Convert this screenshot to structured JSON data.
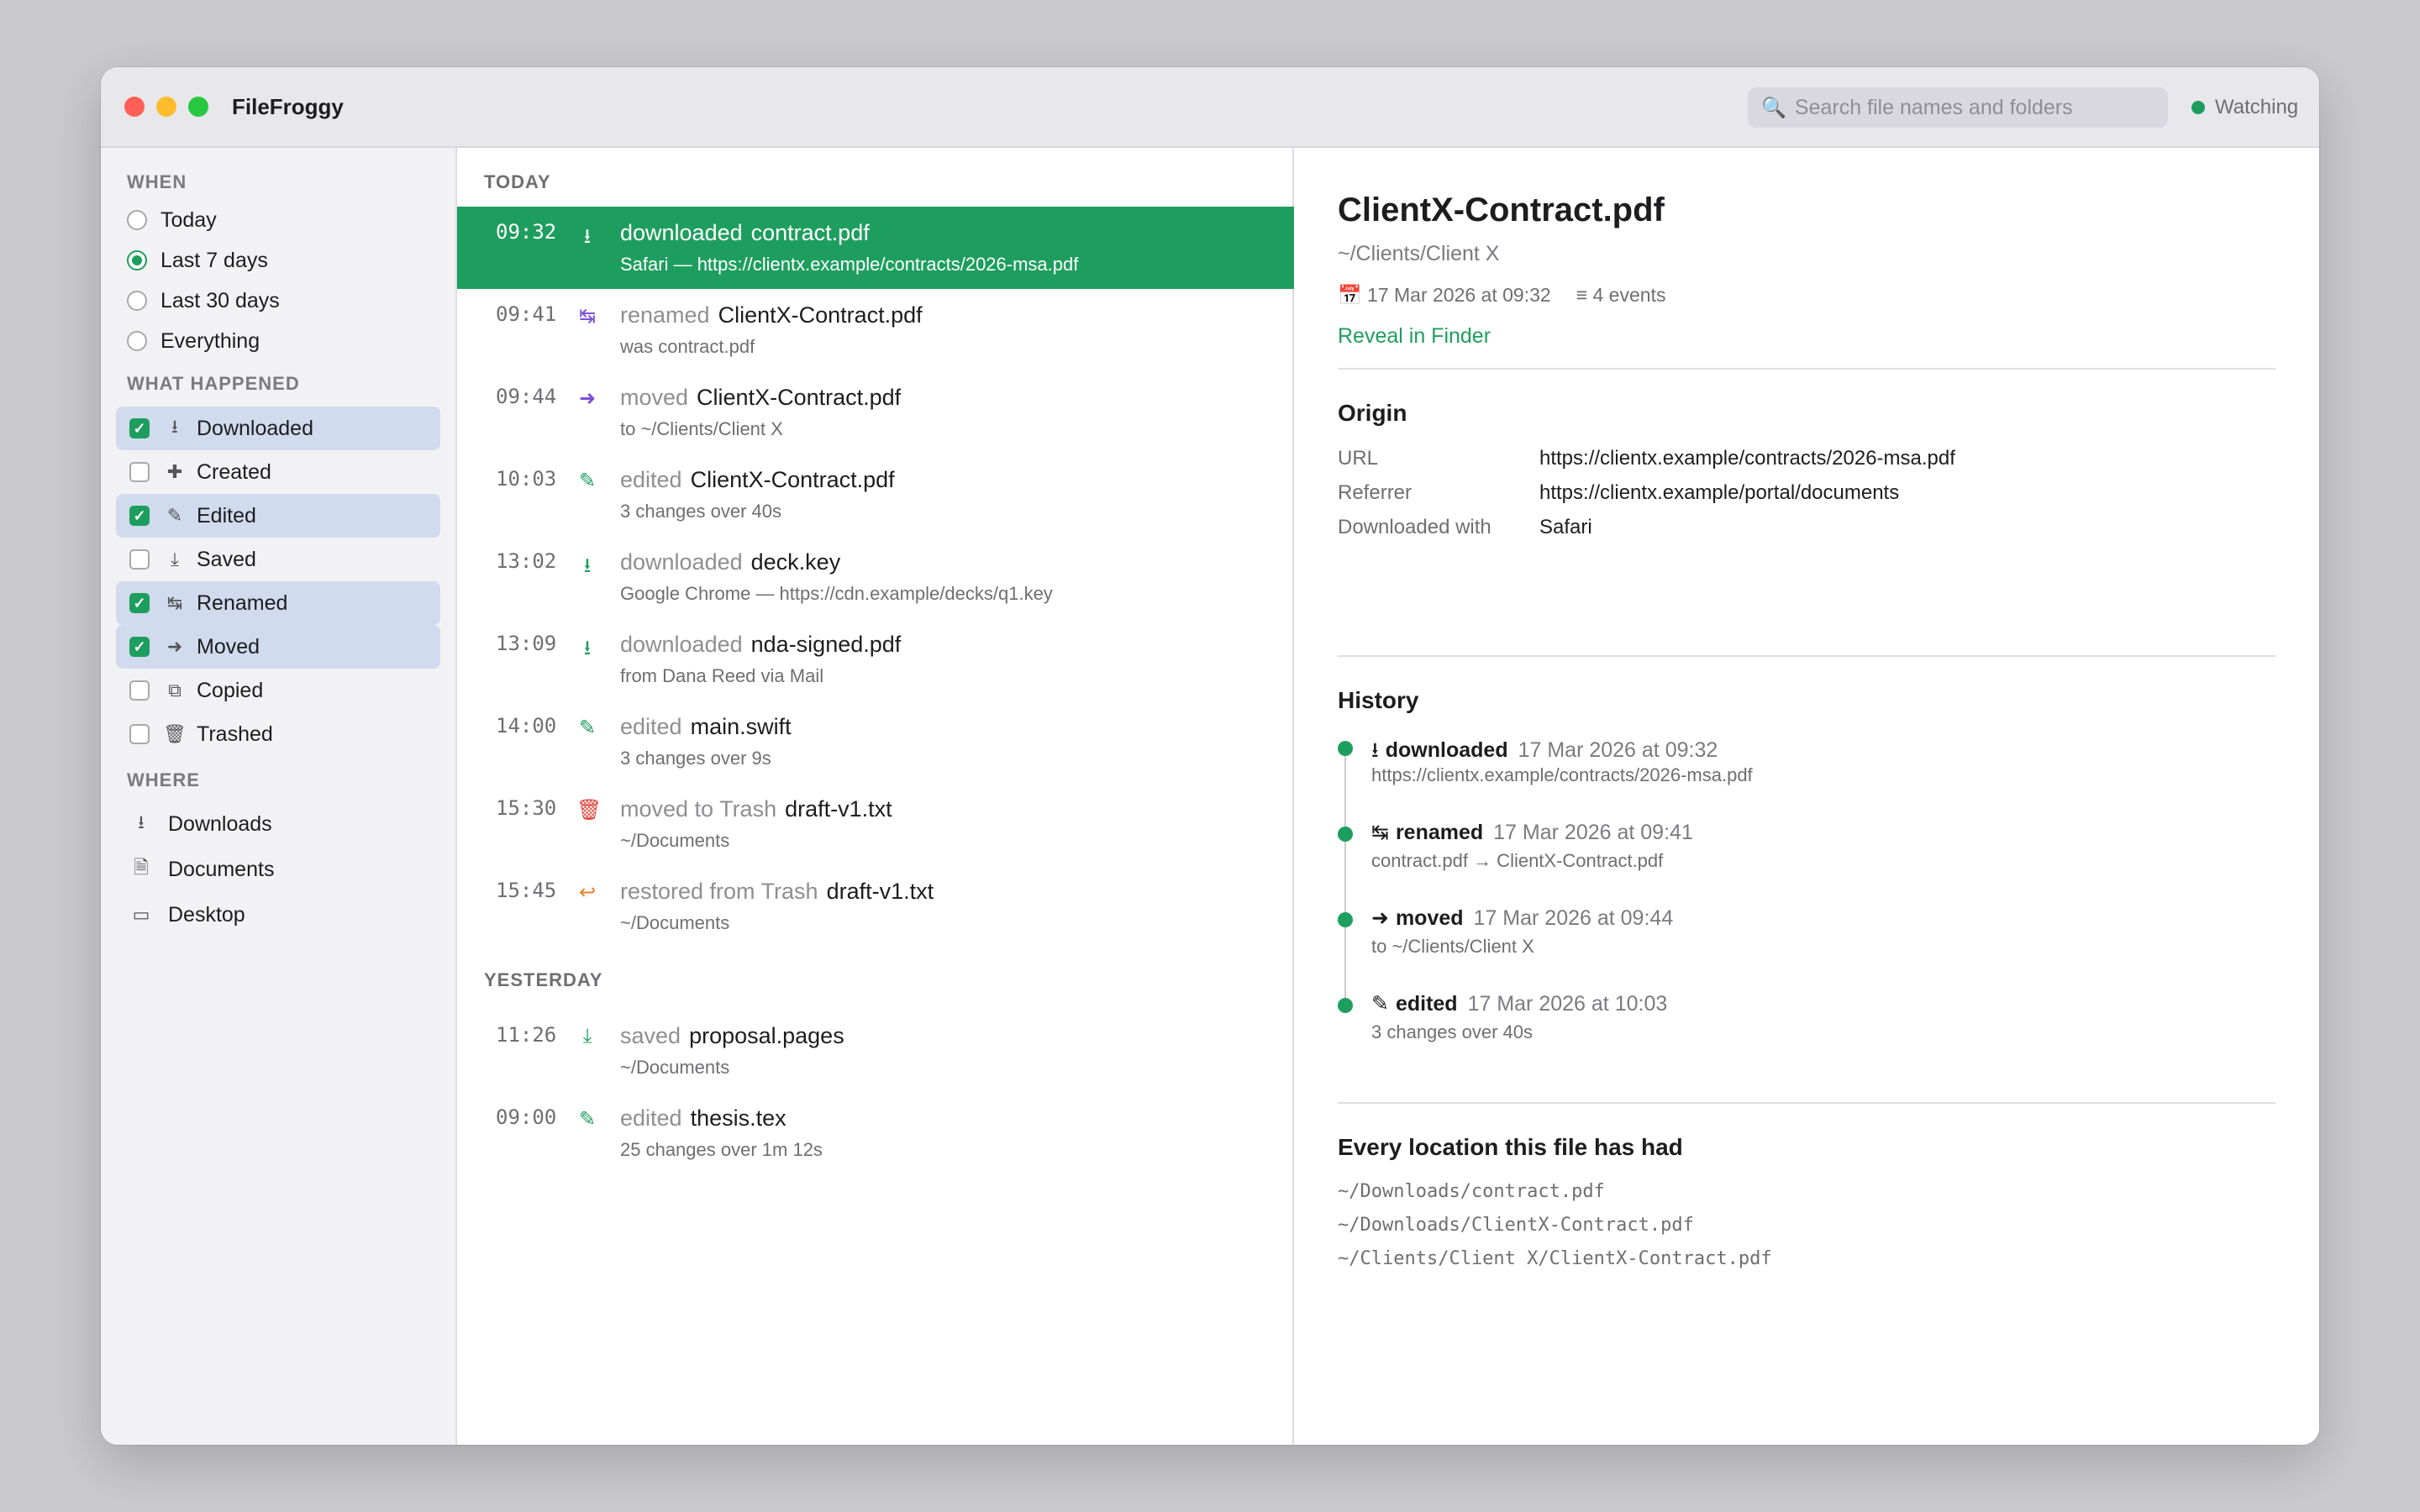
{
  "app": {
    "title": "FileFroggy"
  },
  "search": {
    "placeholder": "Search file names and folders"
  },
  "status": {
    "label": "Watching",
    "color": "#1e9e5e"
  },
  "sidebar": {
    "when_heading": "WHEN",
    "when": [
      {
        "label": "Today",
        "selected": false
      },
      {
        "label": "Last 7 days",
        "selected": true
      },
      {
        "label": "Last 30 days",
        "selected": false
      },
      {
        "label": "Everything",
        "selected": false
      }
    ],
    "what_heading": "WHAT HAPPENED",
    "what": [
      {
        "label": "Downloaded",
        "icon": "⭳",
        "checked": true
      },
      {
        "label": "Created",
        "icon": "✚",
        "checked": false
      },
      {
        "label": "Edited",
        "icon": "✎",
        "checked": true
      },
      {
        "label": "Saved",
        "icon": "⤓",
        "checked": false
      },
      {
        "label": "Renamed",
        "icon": "↹",
        "checked": true
      },
      {
        "label": "Moved",
        "icon": "➜",
        "checked": true
      },
      {
        "label": "Copied",
        "icon": "⧉",
        "checked": false
      },
      {
        "label": "Trashed",
        "icon": "🗑",
        "checked": false
      }
    ],
    "where_heading": "WHERE",
    "where": [
      {
        "label": "Downloads",
        "icon": "⭳"
      },
      {
        "label": "Documents",
        "icon": "🗎"
      },
      {
        "label": "Desktop",
        "icon": "▭"
      }
    ]
  },
  "timeline": {
    "today_heading": "TODAY",
    "yesterday_heading": "YESTERDAY",
    "today": [
      {
        "time": "09:32",
        "icon": "⭳",
        "icon_color": "#1e9e5e",
        "action": "downloaded",
        "file": "contract.pdf",
        "sub": "Safari — https://clientx.example/contracts/2026-msa.pdf",
        "selected": true
      },
      {
        "time": "09:41",
        "icon": "↹",
        "icon_color": "#7b4fd6",
        "action": "renamed",
        "file": "ClientX-Contract.pdf",
        "sub": "was contract.pdf",
        "selected": false
      },
      {
        "time": "09:44",
        "icon": "➜",
        "icon_color": "#7b4fd6",
        "action": "moved",
        "file": "ClientX-Contract.pdf",
        "sub": "to ~/Clients/Client X",
        "selected": false
      },
      {
        "time": "10:03",
        "icon": "✎",
        "icon_color": "#1e9e5e",
        "action": "edited",
        "file": "ClientX-Contract.pdf",
        "sub": "3 changes over 40s",
        "selected": false
      },
      {
        "time": "13:02",
        "icon": "⭳",
        "icon_color": "#1e9e5e",
        "action": "downloaded",
        "file": "deck.key",
        "sub": "Google Chrome — https://cdn.example/decks/q1.key",
        "selected": false
      },
      {
        "time": "13:09",
        "icon": "⭳",
        "icon_color": "#1e9e5e",
        "action": "downloaded",
        "file": "nda-signed.pdf",
        "sub": "from Dana Reed via Mail",
        "selected": false
      },
      {
        "time": "14:00",
        "icon": "✎",
        "icon_color": "#1e9e5e",
        "action": "edited",
        "file": "main.swift",
        "sub": "3 changes over 9s",
        "selected": false
      },
      {
        "time": "15:30",
        "icon": "🗑",
        "icon_color": "#e0413a",
        "action": "moved to Trash",
        "file": "draft-v1.txt",
        "sub": "~/Documents",
        "selected": false
      },
      {
        "time": "15:45",
        "icon": "↩",
        "icon_color": "#e8832a",
        "action": "restored from Trash",
        "file": "draft-v1.txt",
        "sub": "~/Documents",
        "selected": false
      }
    ],
    "yesterday": [
      {
        "time": "11:26",
        "icon": "⤓",
        "icon_color": "#1e9e5e",
        "action": "saved",
        "file": "proposal.pages",
        "sub": "~/Documents",
        "selected": false
      },
      {
        "time": "09:00",
        "icon": "✎",
        "icon_color": "#1e9e5e",
        "action": "edited",
        "file": "thesis.tex",
        "sub": "25 changes over 1m 12s",
        "selected": false
      }
    ]
  },
  "detail": {
    "title": "ClientX-Contract.pdf",
    "path": "~/Clients/Client X",
    "date": "📅 17 Mar 2026 at 09:32",
    "events": "≡ 4 events",
    "reveal": "Reveal in Finder",
    "origin_heading": "Origin",
    "origin": [
      {
        "key": "URL",
        "value": "https://clientx.example/contracts/2026-msa.pdf"
      },
      {
        "key": "Referrer",
        "value": "https://clientx.example/portal/documents"
      },
      {
        "key": "Downloaded with",
        "value": "Safari"
      }
    ],
    "history_heading": "History",
    "history": [
      {
        "icon": "⭳",
        "action": "downloaded",
        "when": "17 Mar 2026 at 09:32",
        "sub": "https://clientx.example/contracts/2026-msa.pdf"
      },
      {
        "icon": "↹",
        "action": "renamed",
        "when": "17 Mar 2026 at 09:41",
        "sub": "contract.pdf → ClientX-Contract.pdf"
      },
      {
        "icon": "➜",
        "action": "moved",
        "when": "17 Mar 2026 at 09:44",
        "sub": "to ~/Clients/Client X"
      },
      {
        "icon": "✎",
        "action": "edited",
        "when": "17 Mar 2026 at 10:03",
        "sub": "3 changes over 40s"
      }
    ],
    "locations_heading": "Every location this file has had",
    "locations": [
      "~/Downloads/contract.pdf",
      "~/Downloads/ClientX-Contract.pdf",
      "~/Clients/Client X/ClientX-Contract.pdf"
    ]
  }
}
